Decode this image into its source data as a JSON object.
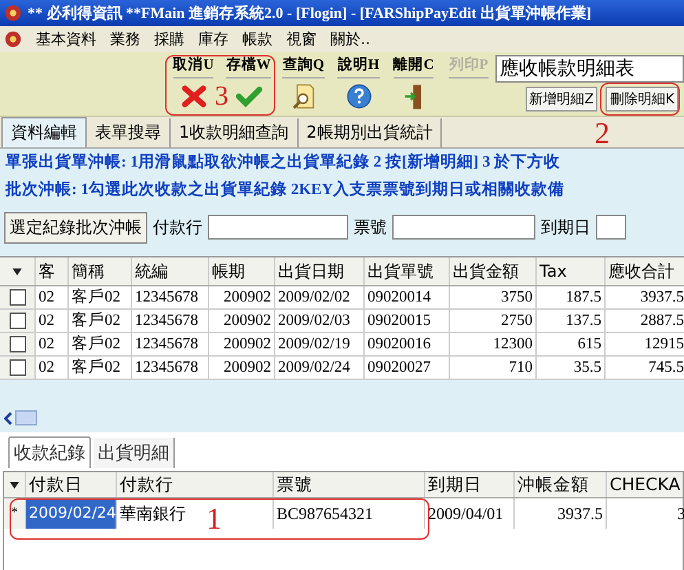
{
  "window": {
    "title": "** 必利得資訊 **FMain  進銷存系統2.0 - [Flogin] - [FARShipPayEdit 出貨單沖帳作業]"
  },
  "menu": [
    "基本資料",
    "業務",
    "採購",
    "庫存",
    "帳款",
    "視窗",
    "關於.."
  ],
  "toolbar": {
    "buttons": [
      {
        "label": "取消U",
        "kind": "cancel",
        "disabled": false
      },
      {
        "label": "存檔W",
        "kind": "save",
        "disabled": false
      },
      {
        "label": "查詢Q",
        "kind": "search",
        "disabled": false
      },
      {
        "label": "說明H",
        "kind": "help",
        "disabled": false
      },
      {
        "label": "離開C",
        "kind": "exit",
        "disabled": false
      },
      {
        "label": "列印P",
        "kind": "print",
        "disabled": true
      }
    ],
    "report_select": {
      "value": "應收帳款明細表"
    },
    "detail_buttons": [
      "新增明細Z",
      "刪除明細K"
    ]
  },
  "tabs": [
    {
      "label": "資料編輯",
      "selected": true
    },
    {
      "label": "表單搜尋",
      "selected": false
    },
    {
      "label": "1收款明細查詢",
      "selected": false
    },
    {
      "label": "2帳期別出貨統計",
      "selected": false
    }
  ],
  "instructions": [
    "單張出貨單沖帳: 1用滑鼠點取欲沖帳之出貨單紀錄  2 按[新增明細]  3 於下方收",
    "批次沖帳: 1勾選此次收款之出貨單紀錄  2KEY入支票票號到期日或相關收款備"
  ],
  "batch": {
    "button": "選定紀錄批次沖帳",
    "fields": [
      {
        "label": "付款行"
      },
      {
        "label": "票號"
      },
      {
        "label": "到期日"
      }
    ]
  },
  "shipments": {
    "columns": [
      "客",
      "簡稱",
      "統編",
      "帳期",
      "出貨日期",
      "出貨單號",
      "出貨金額",
      "Tax",
      "應收合計"
    ],
    "rows": [
      {
        "checked": false,
        "cells": [
          "02",
          "客戶02",
          "12345678",
          "200902",
          "2009/02/02",
          "09020014",
          "3750",
          "187.5",
          "3937.5"
        ]
      },
      {
        "checked": false,
        "cells": [
          "02",
          "客戶02",
          "12345678",
          "200902",
          "2009/02/03",
          "09020015",
          "2750",
          "137.5",
          "2887.5"
        ]
      },
      {
        "checked": false,
        "cells": [
          "02",
          "客戶02",
          "12345678",
          "200902",
          "2009/02/19",
          "09020016",
          "12300",
          "615",
          "12915"
        ]
      },
      {
        "checked": false,
        "cells": [
          "02",
          "客戶02",
          "12345678",
          "200902",
          "2009/02/24",
          "09020027",
          "710",
          "35.5",
          "745.5"
        ]
      }
    ]
  },
  "lower_tabs": [
    {
      "label": "收款紀錄",
      "selected": true
    },
    {
      "label": "出貨明細",
      "selected": false
    }
  ],
  "payments": {
    "columns": [
      "付款日",
      "付款行",
      "票號",
      "到期日",
      "沖帳金額",
      "CHECKA"
    ],
    "rows": [
      {
        "indicator": "*",
        "cells": [
          "2009/02/24",
          "華南銀行",
          "BC987654321",
          "2009/04/01",
          "3937.5",
          "3"
        ]
      }
    ]
  },
  "annotations": [
    "3",
    "2",
    "1"
  ]
}
